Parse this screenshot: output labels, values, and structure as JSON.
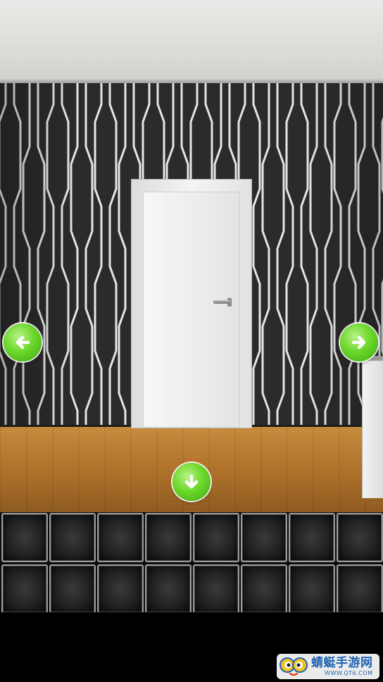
{
  "scene": {
    "room": "room-with-white-door",
    "wall_pattern": "black-wallpaper-with-white-vertical-lines",
    "floor": "wooden-floor"
  },
  "navigation": {
    "left": {
      "icon": "arrow-left-icon"
    },
    "right": {
      "icon": "arrow-right-icon"
    },
    "down": {
      "icon": "arrow-down-icon"
    }
  },
  "inventory": {
    "rows": 2,
    "columns": 8,
    "slots": [
      "",
      "",
      "",
      "",
      "",
      "",
      "",
      "",
      "",
      "",
      "",
      "",
      "",
      "",
      "",
      ""
    ]
  },
  "watermark": {
    "title": "蜻蜓手游网",
    "subtitle": "WWW.QT6.COM"
  },
  "colors": {
    "nav_button": "#5cc920",
    "wall": "#2b2b2b",
    "wall_lines": "#e6e6e6",
    "door": "#f2f2f2",
    "floor": "#b2742b",
    "slot_border": "#9a9a9a"
  }
}
